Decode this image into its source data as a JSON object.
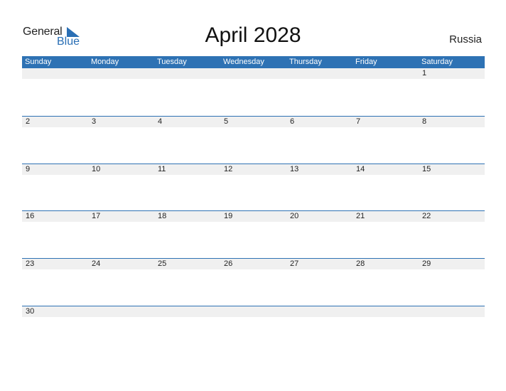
{
  "logo": {
    "line1": "General",
    "line2": "Blue"
  },
  "title": "April 2028",
  "country": "Russia",
  "weekdays": [
    "Sunday",
    "Monday",
    "Tuesday",
    "Wednesday",
    "Thursday",
    "Friday",
    "Saturday"
  ],
  "weeks": [
    [
      "",
      "",
      "",
      "",
      "",
      "",
      "1"
    ],
    [
      "2",
      "3",
      "4",
      "5",
      "6",
      "7",
      "8"
    ],
    [
      "9",
      "10",
      "11",
      "12",
      "13",
      "14",
      "15"
    ],
    [
      "16",
      "17",
      "18",
      "19",
      "20",
      "21",
      "22"
    ],
    [
      "23",
      "24",
      "25",
      "26",
      "27",
      "28",
      "29"
    ],
    [
      "30",
      "",
      "",
      "",
      "",
      "",
      ""
    ]
  ],
  "colors": {
    "accent": "#2e72b4",
    "band": "#f0f0f0"
  }
}
